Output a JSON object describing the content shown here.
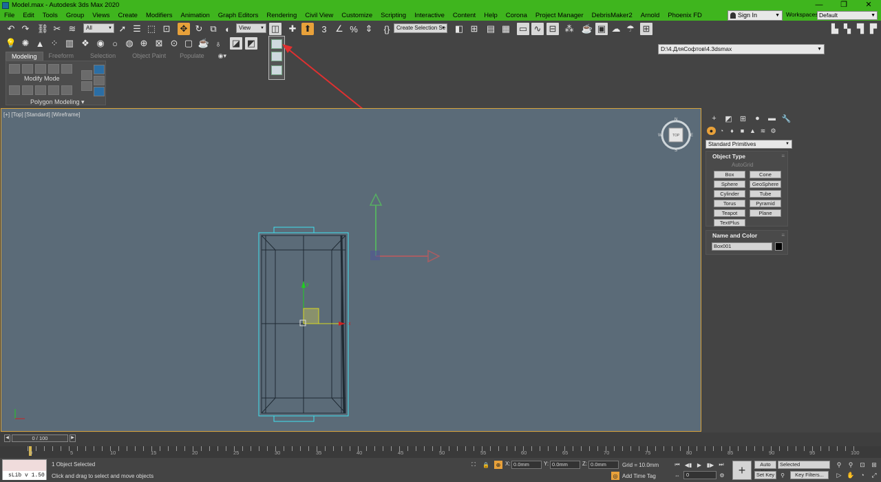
{
  "window": {
    "title": "Model.max - Autodesk 3ds Max 2020",
    "controls": [
      "—",
      "❐",
      "✕"
    ]
  },
  "menu": [
    "File",
    "Edit",
    "Tools",
    "Group",
    "Views",
    "Create",
    "Modifiers",
    "Animation",
    "Graph Editors",
    "Rendering",
    "Civil View",
    "Customize",
    "Scripting",
    "Interactive",
    "Content",
    "Help",
    "Corona",
    "Project Manager",
    "DebrisMaker2",
    "Arnold",
    "Phoenix FD"
  ],
  "signin": "Sign In",
  "workspaces": {
    "label": "Workspaces:",
    "value": "Default"
  },
  "toolbar": {
    "filter": "All",
    "refcoord": "View",
    "selection_set": "Create Selection Se",
    "path": "D:\\4.ДляСофтов\\4.3dsmax"
  },
  "ribbon": {
    "tabs": [
      "Modeling",
      "Freeform",
      "Selection",
      "Object Paint",
      "Populate"
    ],
    "modify_mode": "Modify Mode",
    "polygon_modeling": "Polygon Modeling ▾"
  },
  "viewport": {
    "label": "[+] [Top] [Standard] [Wireframe]",
    "viewcube": {
      "face": "TOP",
      "n": "N",
      "s": "S",
      "e": "E",
      "w": "W"
    },
    "gizmo": {
      "x": "x",
      "y": "y"
    }
  },
  "command_panel": {
    "category": "Standard Primitives",
    "object_type": {
      "title": "Object Type",
      "autogrid": "AutoGrid",
      "buttons": [
        "Box",
        "Cone",
        "Sphere",
        "GeoSphere",
        "Cylinder",
        "Tube",
        "Torus",
        "Pyramid",
        "Teapot",
        "Plane",
        "TextPlus"
      ]
    },
    "name_color": {
      "title": "Name and Color",
      "name": "Box001",
      "color": "#000000"
    }
  },
  "timeline": {
    "frame": "0 / 100",
    "ticks": [
      "0",
      "5",
      "10",
      "15",
      "20",
      "25",
      "30",
      "35",
      "40",
      "45",
      "50",
      "55",
      "60",
      "65",
      "70",
      "75",
      "80",
      "85",
      "90",
      "95",
      "100"
    ]
  },
  "status": {
    "maxscript": "sLib v 1.50",
    "selected": "1 Object Selected",
    "prompt": "Click and drag to select and move objects",
    "x_label": "X:",
    "x": "0.0mm",
    "y_label": "Y:",
    "y": "0.0mm",
    "z_label": "Z:",
    "z": "0.0mm",
    "grid": "Grid = 10.0mm",
    "add_time_tag": "Add Time Tag",
    "current_frame": "0",
    "auto_key": "Auto Key",
    "set_key": "Set Key",
    "key_selection": "Selected",
    "key_filters": "Key Filters..."
  },
  "colors": {
    "titlebar": "#3fb51e",
    "viewport_bg": "#5b6b78",
    "selection": "#3fe0f0",
    "active_border": "#d9a43b",
    "annotation_arrow": "#e03030"
  }
}
